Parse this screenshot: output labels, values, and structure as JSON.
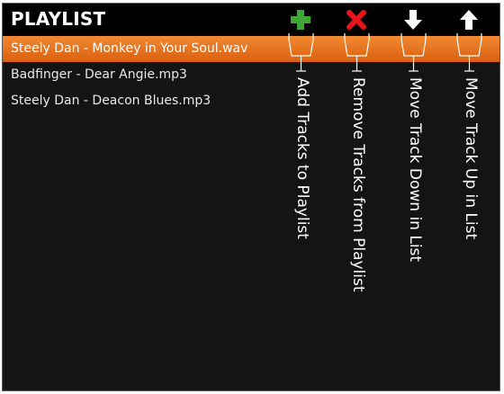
{
  "header": {
    "title": "PLAYLIST"
  },
  "toolbar": {
    "items": [
      {
        "name": "add",
        "icon": "plus-icon",
        "color": "#3fa535",
        "label": "Add Tracks to Playlist"
      },
      {
        "name": "remove",
        "icon": "x-icon",
        "color": "#e8141c",
        "label": "Remove Tracks from Playlist"
      },
      {
        "name": "move-down",
        "icon": "arrow-down-icon",
        "color": "#ffffff",
        "label": "Move Track Down in List"
      },
      {
        "name": "move-up",
        "icon": "arrow-up-icon",
        "color": "#ffffff",
        "label": "Move Track Up in List"
      }
    ]
  },
  "playlist": {
    "tracks": [
      {
        "label": "Steely Dan - Monkey in Your Soul.wav",
        "selected": true
      },
      {
        "label": "Badfinger - Dear Angie.mp3",
        "selected": false
      },
      {
        "label": "Steely Dan - Deacon Blues.mp3",
        "selected": false
      }
    ]
  },
  "colors": {
    "selection": "#e0691a",
    "background": "#141414",
    "header": "#000000"
  }
}
